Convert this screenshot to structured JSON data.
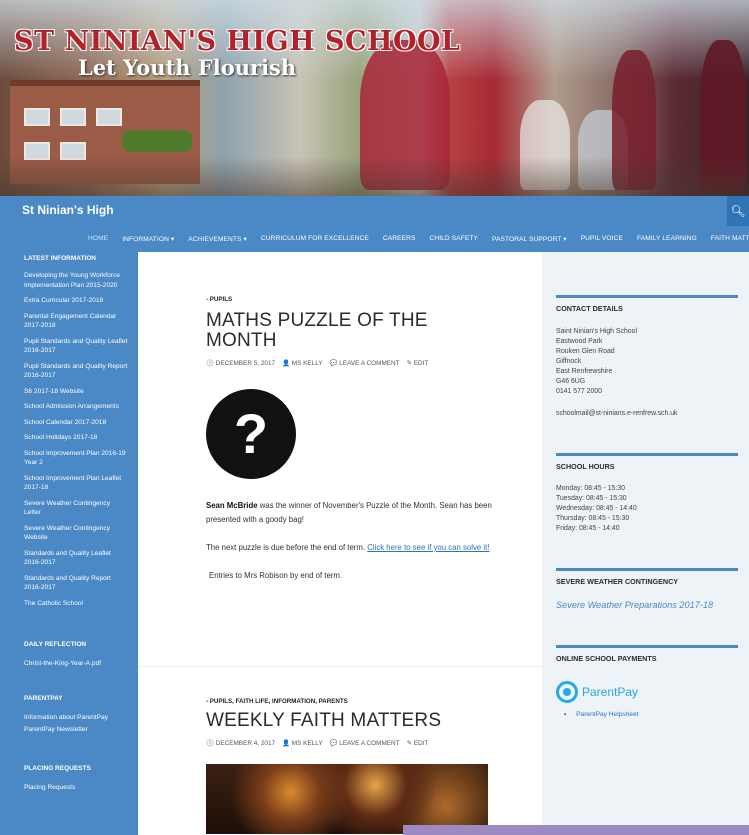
{
  "banner": {
    "title_line1": "ST NINIAN'S HIGH SCHOOL",
    "title_line2": "Let Youth Flourish"
  },
  "header": {
    "site_title": "St Ninian's High",
    "search_icon": "search-icon"
  },
  "nav": {
    "items": [
      {
        "label": "HOME"
      },
      {
        "label": "INFORMATION ▾"
      },
      {
        "label": "ACHIEVEMENTS ▾"
      },
      {
        "label": "CURRICULUM FOR EXCELLENCE"
      },
      {
        "label": "CAREERS"
      },
      {
        "label": "CHILD SAFETY"
      },
      {
        "label": "PASTORAL SUPPORT ▾"
      },
      {
        "label": "PUPIL VOICE"
      },
      {
        "label": "FAMILY LEARNING"
      },
      {
        "label": "FAITH MATTERS"
      }
    ]
  },
  "leftbar": {
    "latest_head": "LATEST INFORMATION",
    "latest": [
      "Developing the Young Workforce Implementation Plan 2015-2020",
      "Extra Curricular 2017-2018",
      "Parental Engagement Calendar 2017-2018",
      "Pupil Standards and Quality Leaflet 2016-2017",
      "Pupil Standards and Quality Report 2016-2017",
      "S6 2017-18 Website",
      "School Admission Arrangements",
      "School Calendar 2017-2018",
      "School Holidays 2017-18",
      "School Improvement Plan 2016-19 Year 2",
      "School Improvement Plan Leaflet 2017-18",
      "Severe Weather Contingency Letter",
      "Severe Weather Contingency Website",
      "Standards and Quality Leaflet 2016-2017",
      "Standards and Quality Report 2016-2017",
      "The Catholic School"
    ],
    "reflection_head": "DAILY REFLECTION",
    "reflection_link": "Christ-the-King-Year-A.pdf",
    "parentpay_head": "PARENTPAY",
    "parentpay_links": [
      "Information about ParentPay",
      "ParentPay Newsletter"
    ],
    "placing_head": "PLACING REQUESTS",
    "placing_link": "Placing Requests"
  },
  "post1": {
    "category": "- PUPILS",
    "title": "MATHS PUZZLE OF THE MONTH",
    "date": "🕓 DECEMBER 5, 2017",
    "author": "👤 MS KELLY",
    "comment": "💬 LEAVE A COMMENT",
    "edit": "✎ EDIT",
    "image_glyph": "?",
    "winner_name": "Sean McBride",
    "winner_text": " was the winner of November's Puzzle of the Month. Sean has been presented with a goody bag!",
    "next_text": "The next puzzle is due before the end of term. ",
    "next_link": "Click here to see if you can solve it!",
    "entries_text": "Entries to Mrs Robison by end of term."
  },
  "post2": {
    "category": "- PUPILS, FAITH LIFE, INFORMATION, PARENTS",
    "title": "WEEKLY FAITH MATTERS",
    "date": "🕓 DECEMBER 4, 2017",
    "author": "👤 MS KELLY",
    "comment": "💬 LEAVE A COMMENT",
    "edit": "✎ EDIT"
  },
  "rightbar": {
    "contact_head": "CONTACT DETAILS",
    "address": [
      "Saint Ninian's High School",
      "Eastwood Park",
      "Rouken Glen Road",
      "Giffnock",
      "East Renfrewshire",
      "G46 6UG",
      "0141 577 2000"
    ],
    "email": "schoolmail@st-ninians.e-renfrew.sch.uk",
    "hours_head": "SCHOOL HOURS",
    "hours": [
      "Monday: 08:45 - 15:30",
      "Tuesday: 08:45 - 15:30",
      "Wednesday: 08:45 - 14:40",
      "Thursday: 08:45 - 15:30",
      "Friday: 08:45 - 14:40"
    ],
    "weather_head": "SEVERE WEATHER CONTINGENCY",
    "weather_link": "Severe Weather Preparations 2017-18",
    "payments_head": "ONLINE SCHOOL PAYMENTS",
    "parentpay_logo": "ParentPay",
    "helpsheet": "ParentPay Helpsheet"
  },
  "colors": {
    "accent": "#4a89c6",
    "dark_accent": "#2f74b5",
    "parentpay": "#27a9e1"
  }
}
